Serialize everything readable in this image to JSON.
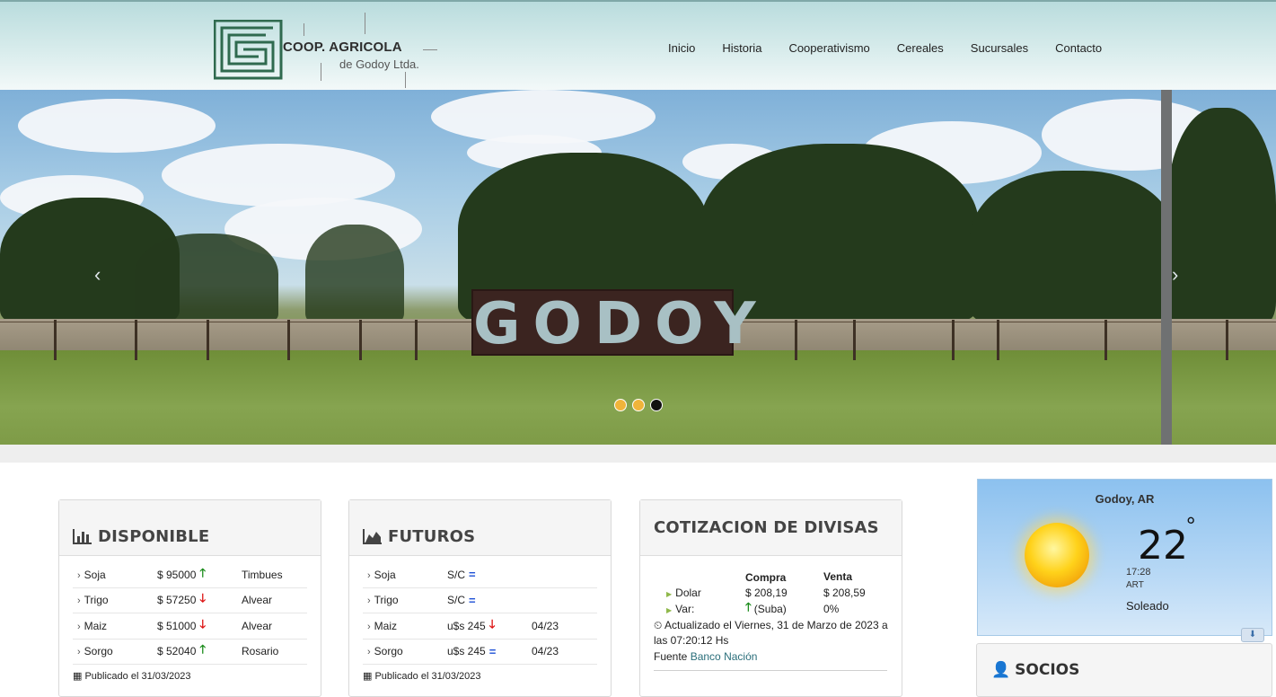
{
  "header": {
    "logo_title": "COOP. AGRICOLA",
    "logo_subtitle": "de Godoy Ltda.",
    "nav": [
      "Inicio",
      "Historia",
      "Cooperativismo",
      "Cereales",
      "Sucursales",
      "Contacto"
    ]
  },
  "hero": {
    "sign_text": "GODOY",
    "prev": "‹",
    "next": "›",
    "dot_colors": [
      "#f0b43a",
      "#f0b43a",
      "#111111"
    ]
  },
  "disponible": {
    "title": "DISPONIBLE",
    "icon": "bar-chart-icon",
    "rows": [
      {
        "name": "Soja",
        "price": "$ 95000",
        "trend": "up",
        "place": "Timbues"
      },
      {
        "name": "Trigo",
        "price": "$ 57250",
        "trend": "down",
        "place": "Alvear"
      },
      {
        "name": "Maiz",
        "price": "$ 51000",
        "trend": "down",
        "place": "Alvear"
      },
      {
        "name": "Sorgo",
        "price": "$ 52040",
        "trend": "up",
        "place": "Rosario"
      }
    ],
    "published": "Publicado el 31/03/2023"
  },
  "futuros": {
    "title": "FUTUROS",
    "icon": "area-chart-icon",
    "rows": [
      {
        "name": "Soja",
        "price": "S/C",
        "trend": "eq",
        "place": ""
      },
      {
        "name": "Trigo",
        "price": "S/C",
        "trend": "eq",
        "place": ""
      },
      {
        "name": "Maiz",
        "price": "u$s 245",
        "trend": "down",
        "place": "04/23"
      },
      {
        "name": "Sorgo",
        "price": "u$s 245",
        "trend": "eq",
        "place": "04/23"
      }
    ],
    "published": "Publicado el 31/03/2023"
  },
  "divisas": {
    "title": "COTIZACION DE DIVISAS",
    "col_compra": "Compra",
    "col_venta": "Venta",
    "dolar_label": "Dolar",
    "dolar_compra": "$ 208,19",
    "dolar_venta": "$ 208,59",
    "var_label": "Var:",
    "var_value": "(Suba)",
    "var_pct": "0%",
    "updated": "Actualizado el Viernes, 31 de Marzo de 2023 a las 07:20:12 Hs",
    "source_label": "Fuente",
    "source_link": "Banco Nación"
  },
  "weather": {
    "location": "Godoy, AR",
    "temp": "22",
    "deg": "°",
    "time": "17:28",
    "tz": "ART",
    "condition": "Soleado"
  },
  "socios": {
    "title": "SOCIOS"
  },
  "colors": {
    "up": "#1c8c1c",
    "down": "#d11111",
    "eq": "#1c4fd6",
    "link": "#2a6e7a"
  }
}
